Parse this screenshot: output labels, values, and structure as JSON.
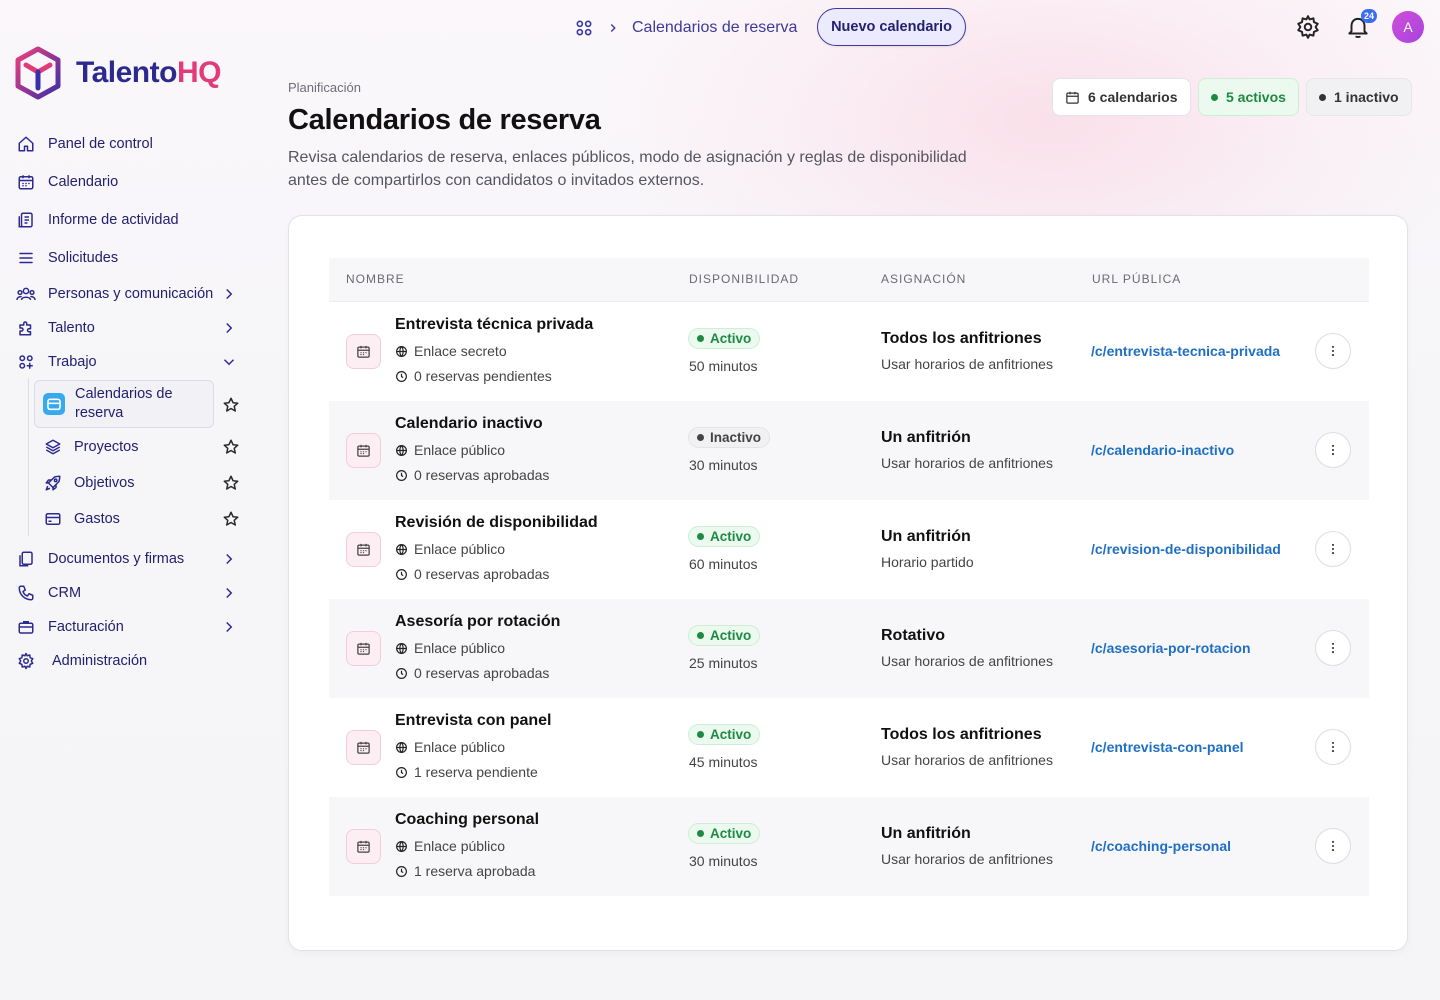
{
  "app": {
    "logo_part1": "Talento",
    "logo_part2": "HQ"
  },
  "topbar": {
    "breadcrumb_current": "Calendarios de reserva",
    "new_button": "Nuevo calendario",
    "notification_count": "24",
    "avatar_initial": "A"
  },
  "sidebar": {
    "items": [
      {
        "label": "Panel de control"
      },
      {
        "label": "Calendario"
      },
      {
        "label": "Informe de actividad"
      },
      {
        "label": "Solicitudes"
      },
      {
        "label": "Personas y comunicación"
      },
      {
        "label": "Talento"
      },
      {
        "label": "Trabajo"
      },
      {
        "label": "Documentos y firmas"
      },
      {
        "label": "CRM"
      },
      {
        "label": "Facturación"
      },
      {
        "label": "Administración"
      }
    ],
    "subitems": [
      {
        "label": "Calendarios de reserva"
      },
      {
        "label": "Proyectos"
      },
      {
        "label": "Objetivos"
      },
      {
        "label": "Gastos"
      }
    ]
  },
  "header": {
    "eyebrow": "Planificación",
    "title": "Calendarios de reserva",
    "description": "Revisa calendarios de reserva, enlaces públicos, modo de asignación y reglas de disponibilidad antes de compartirlos con candidatos o invitados externos.",
    "pills": {
      "total": "6 calendarios",
      "active": "5 activos",
      "inactive": "1 inactivo"
    }
  },
  "table": {
    "headers": {
      "name": "NOMBRE",
      "availability": "DISPONIBILIDAD",
      "assignment": "ASIGNACIÓN",
      "url": "URL PÚBLICA"
    },
    "rows": [
      {
        "name": "Entrevista técnica privada",
        "link": "Enlace secreto",
        "bookings": "0 reservas pendientes",
        "status": "Activo",
        "duration": "50 minutos",
        "assignment": "Todos los anfitriones",
        "schedule": "Usar horarios de anfitriones",
        "url": "/c/entrevista-tecnica-privada"
      },
      {
        "name": "Calendario inactivo",
        "link": "Enlace público",
        "bookings": "0 reservas aprobadas",
        "status": "Inactivo",
        "duration": "30 minutos",
        "assignment": "Un anfitrión",
        "schedule": "Usar horarios de anfitriones",
        "url": "/c/calendario-inactivo"
      },
      {
        "name": "Revisión de disponibilidad",
        "link": "Enlace público",
        "bookings": "0 reservas aprobadas",
        "status": "Activo",
        "duration": "60 minutos",
        "assignment": "Un anfitrión",
        "schedule": "Horario partido",
        "url": "/c/revision-de-disponibilidad"
      },
      {
        "name": "Asesoría por rotación",
        "link": "Enlace público",
        "bookings": "0 reservas aprobadas",
        "status": "Activo",
        "duration": "25 minutos",
        "assignment": "Rotativo",
        "schedule": "Usar horarios de anfitriones",
        "url": "/c/asesoria-por-rotacion"
      },
      {
        "name": "Entrevista con panel",
        "link": "Enlace público",
        "bookings": "1 reserva pendiente",
        "status": "Activo",
        "duration": "45 minutos",
        "assignment": "Todos los anfitriones",
        "schedule": "Usar horarios de anfitriones",
        "url": "/c/entrevista-con-panel"
      },
      {
        "name": "Coaching personal",
        "link": "Enlace público",
        "bookings": "1 reserva aprobada",
        "status": "Activo",
        "duration": "30 minutos",
        "assignment": "Un anfitrión",
        "schedule": "Usar horarios de anfitriones",
        "url": "/c/coaching-personal"
      }
    ]
  },
  "colors": {
    "brand_primary": "#2d2a8f",
    "brand_accent": "#e23b7a",
    "active_green": "#1d8a41",
    "link_blue": "#1f6fc4"
  }
}
